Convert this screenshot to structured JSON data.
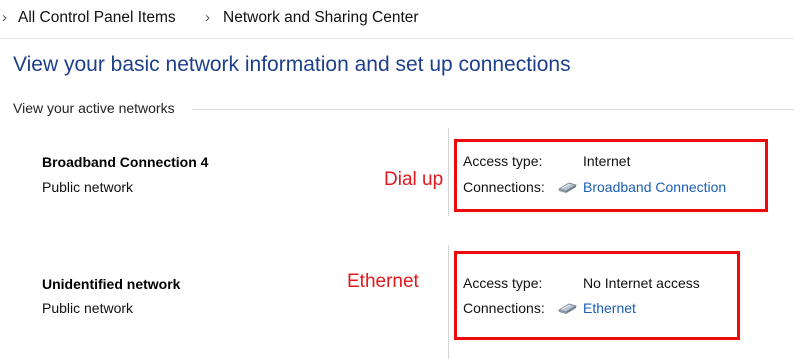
{
  "breadcrumb": {
    "items": [
      "All Control Panel Items",
      "Network and Sharing Center"
    ]
  },
  "page_title": "View your basic network information and set up connections",
  "active_networks_label": "View your active networks",
  "networks": [
    {
      "name": "Broadband Connection 4",
      "type": "Public network",
      "annotation": "Dial up",
      "access_type_label": "Access type:",
      "access_type_value": "Internet",
      "connections_label": "Connections:",
      "connection_link": "Broadband Connection",
      "connection_icon": "network-adapter-icon"
    },
    {
      "name": "Unidentified network",
      "type": "Public network",
      "annotation": "Ethernet",
      "access_type_label": "Access type:",
      "access_type_value": "No Internet access",
      "connections_label": "Connections:",
      "connection_link": "Ethernet",
      "connection_icon": "network-adapter-icon"
    }
  ],
  "colors": {
    "title": "#1e3f8a",
    "link": "#1a5fb4",
    "annotation": "#e0191d",
    "highlight_box": "#ee0a0a"
  }
}
